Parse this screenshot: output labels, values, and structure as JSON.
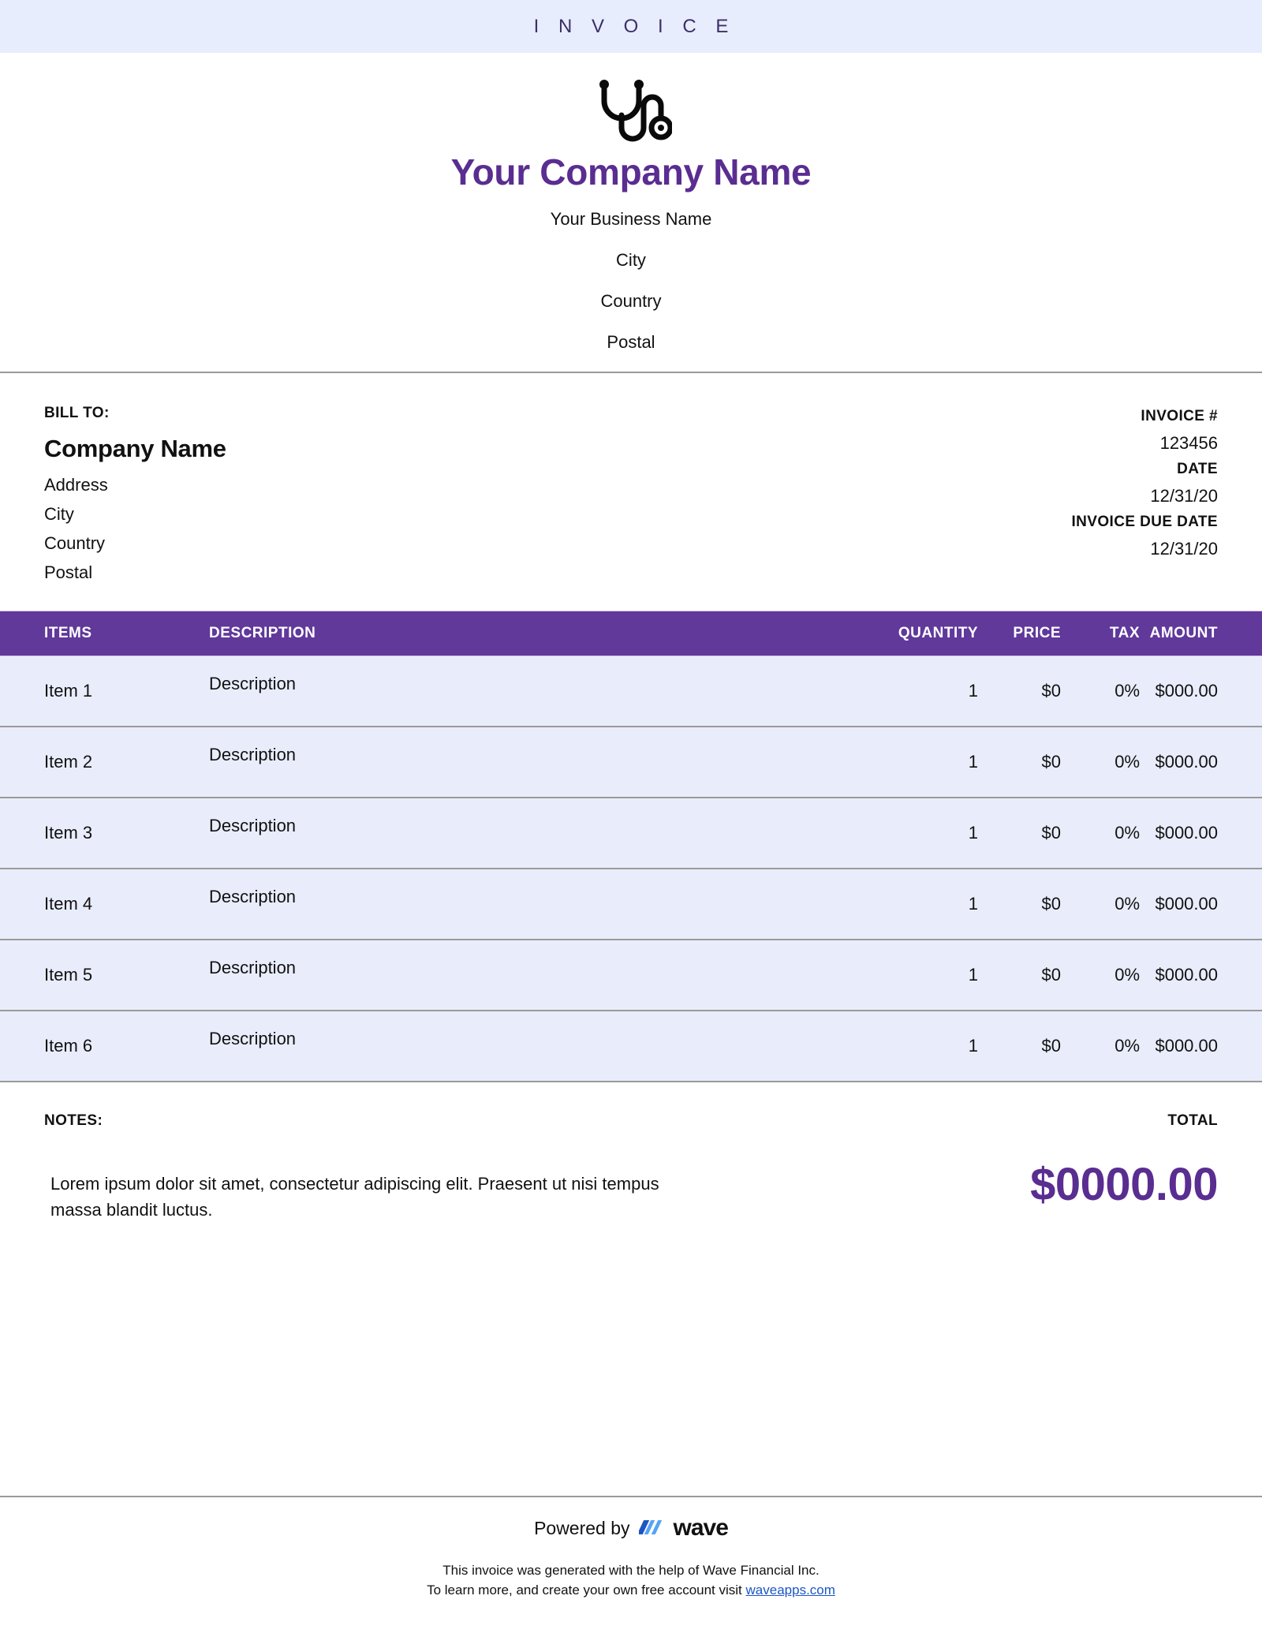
{
  "banner": {
    "title": "I N V O I C E"
  },
  "brand": {
    "accent_purple": "#5a2d91",
    "table_header_purple": "#60399b",
    "row_background": "#e9edfb",
    "banner_background": "#e8edfd",
    "link_blue": "#1b56c4",
    "logo_icon": "stethoscope-icon"
  },
  "company": {
    "name": "Your Company Name",
    "lines": [
      "Your Business Name",
      "City",
      "Country",
      "Postal"
    ]
  },
  "bill_to": {
    "label": "BILL TO:",
    "company": "Company Name",
    "lines": [
      "Address",
      "City",
      "Country",
      "Postal"
    ]
  },
  "invoice_meta": [
    {
      "label": "INVOICE #",
      "value": "123456"
    },
    {
      "label": "DATE",
      "value": "12/31/20"
    },
    {
      "label": "INVOICE DUE DATE",
      "value": "12/31/20"
    }
  ],
  "items_table": {
    "columns": [
      "ITEMS",
      "DESCRIPTION",
      "QUANTITY",
      "PRICE",
      "TAX",
      "AMOUNT"
    ],
    "rows": [
      {
        "item": "Item 1",
        "description": "Description",
        "quantity": "1",
        "price": "$0",
        "tax": "0%",
        "amount": "$000.00"
      },
      {
        "item": "Item 2",
        "description": "Description",
        "quantity": "1",
        "price": "$0",
        "tax": "0%",
        "amount": "$000.00"
      },
      {
        "item": "Item 3",
        "description": "Description",
        "quantity": "1",
        "price": "$0",
        "tax": "0%",
        "amount": "$000.00"
      },
      {
        "item": "Item 4",
        "description": "Description",
        "quantity": "1",
        "price": "$0",
        "tax": "0%",
        "amount": "$000.00"
      },
      {
        "item": "Item 5",
        "description": "Description",
        "quantity": "1",
        "price": "$0",
        "tax": "0%",
        "amount": "$000.00"
      },
      {
        "item": "Item 6",
        "description": "Description",
        "quantity": "1",
        "price": "$0",
        "tax": "0%",
        "amount": "$000.00"
      }
    ]
  },
  "notes": {
    "label": "NOTES:",
    "body": "Lorem ipsum dolor sit amet, consectetur adipiscing elit. Praesent ut nisi tempus massa blandit luctus."
  },
  "total": {
    "label": "TOTAL",
    "value": "$0000.00"
  },
  "footer": {
    "powered_by": "Powered by",
    "wave_wordmark": "wave",
    "fine_print_line1": "This invoice was generated with the help of Wave Financial Inc.",
    "fine_print_line2_prefix": "To learn more, and create your own free account visit ",
    "link_text": "waveapps.com"
  }
}
